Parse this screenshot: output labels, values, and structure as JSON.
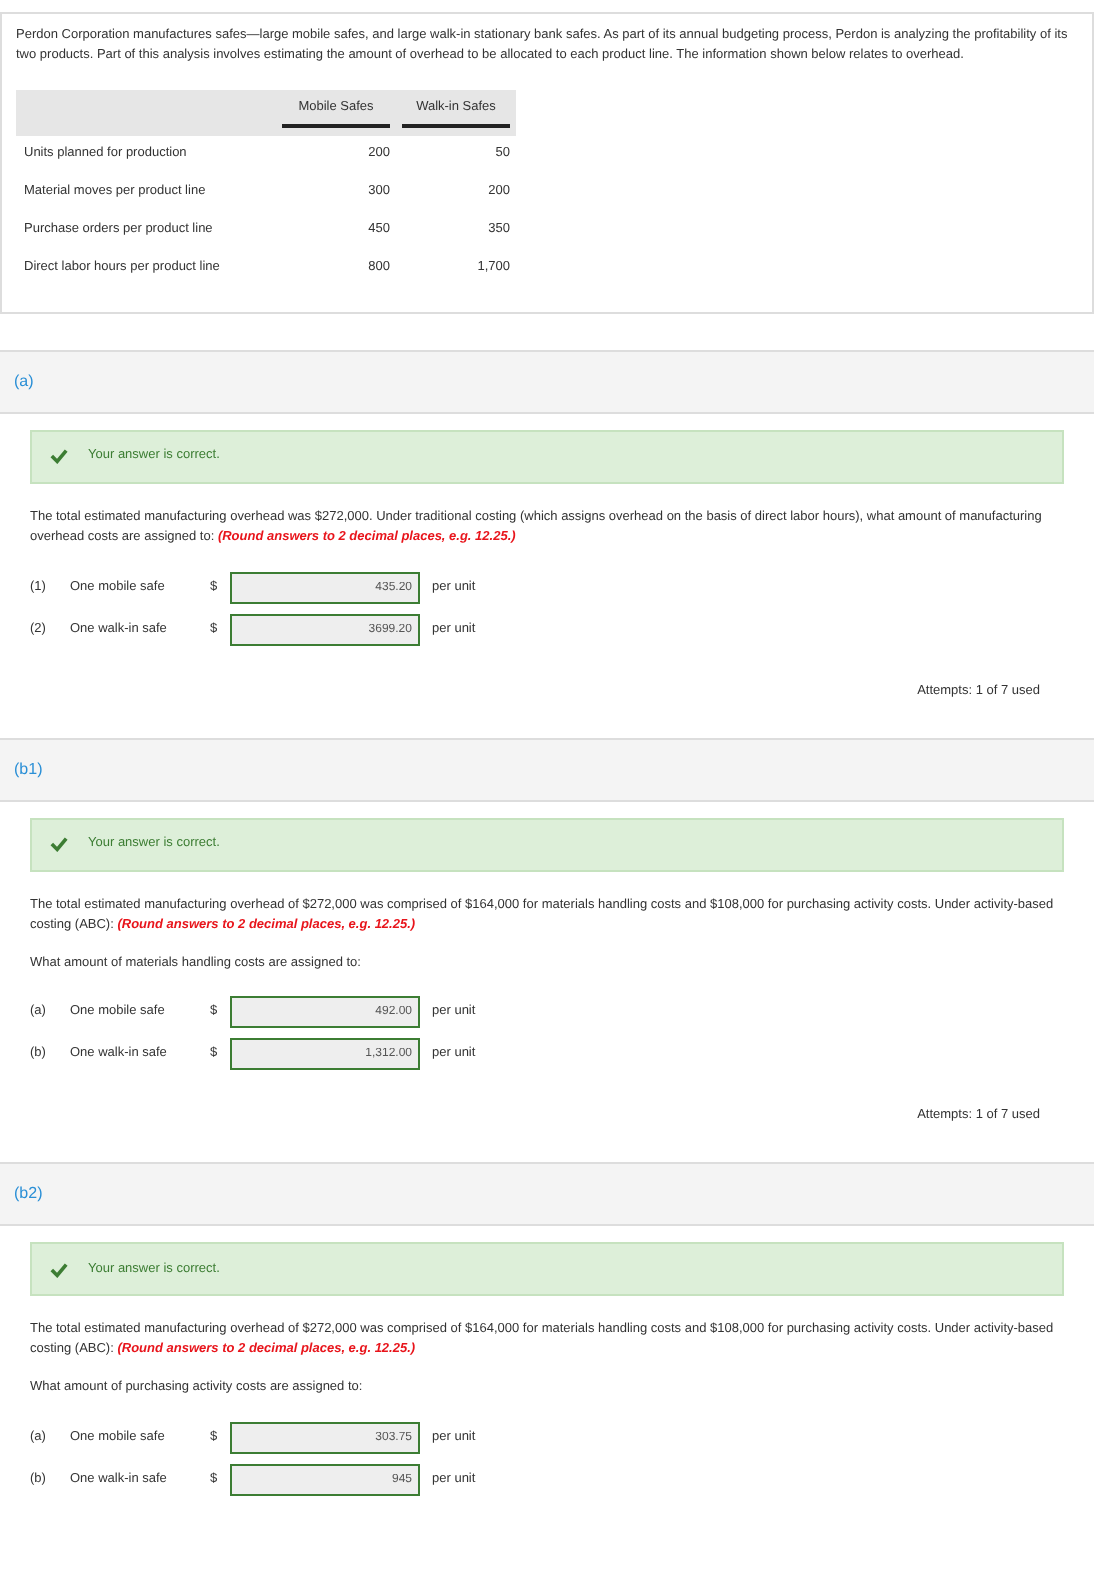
{
  "intro": {
    "text": "Perdon Corporation manufactures safes—large mobile safes, and large walk-in stationary bank safes. As part of its annual budgeting process, Perdon is analyzing the profitability of its two products. Part of this analysis involves estimating the amount of overhead to be allocated to each product line. The information shown below relates to overhead.",
    "table": {
      "columns": [
        "Mobile Safes",
        "Walk-in Safes"
      ],
      "rows": [
        {
          "label": "Units planned for production",
          "values": [
            "200",
            "50"
          ]
        },
        {
          "label": "Material moves per product line",
          "values": [
            "300",
            "200"
          ]
        },
        {
          "label": "Purchase orders per product line",
          "values": [
            "450",
            "350"
          ]
        },
        {
          "label": "Direct labor hours per product line",
          "values": [
            "800",
            "1,700"
          ]
        }
      ]
    }
  },
  "sections": [
    {
      "label": "(a)",
      "feedback": {
        "correct": true,
        "message": "Your answer is correct."
      },
      "question": "The total estimated manufacturing overhead was $272,000. Under traditional costing (which assigns overhead on the basis of direct labor hours), what amount of manufacturing overhead costs are assigned to:",
      "instruction": "(Round answers to 2 decimal places, e.g. 12.25.)",
      "answers": [
        {
          "marker": "(1)",
          "label": "One mobile safe",
          "currency": "$",
          "value": "435.20",
          "unit": "per unit",
          "correct": true
        },
        {
          "marker": "(2)",
          "label": "One walk-in safe",
          "currency": "$",
          "value": "3699.20",
          "unit": "per unit",
          "correct": true
        }
      ],
      "attempts": "Attempts: 1 of 7 used"
    },
    {
      "label": "(b1)",
      "feedback": {
        "correct": true,
        "message": "Your answer is correct."
      },
      "question": "The total estimated manufacturing overhead of $272,000 was comprised of $164,000 for materials handling costs and $108,000 for purchasing activity costs. Under activity-based costing (ABC):",
      "instruction": "(Round answers to 2 decimal places, e.g. 12.25.)",
      "prompt": "What amount of materials handling costs are assigned to:",
      "answers": [
        {
          "marker": "(a)",
          "label": "One mobile safe",
          "currency": "$",
          "value": "492.00",
          "unit": "per unit",
          "correct": true
        },
        {
          "marker": "(b)",
          "label": "One walk-in safe",
          "currency": "$",
          "value": "1,312.00",
          "unit": "per unit",
          "correct": true
        }
      ],
      "attempts": "Attempts: 1 of 7 used"
    },
    {
      "label": "(b2)",
      "feedback": {
        "correct": true,
        "message": "Your answer is correct."
      },
      "question": "The total estimated manufacturing overhead of $272,000 was comprised of $164,000 for materials handling costs and $108,000 for purchasing activity costs. Under activity-based costing (ABC):",
      "instruction": "(Round answers to 2 decimal places, e.g. 12.25.)",
      "prompt": "What amount of purchasing activity costs are assigned to:",
      "answers": [
        {
          "marker": "(a)",
          "label": "One mobile safe",
          "currency": "$",
          "value": "303.75",
          "unit": "per unit",
          "correct": true
        },
        {
          "marker": "(b)",
          "label": "One walk-in safe",
          "currency": "$",
          "value": "945",
          "unit": "per unit",
          "correct": true
        }
      ]
    }
  ]
}
